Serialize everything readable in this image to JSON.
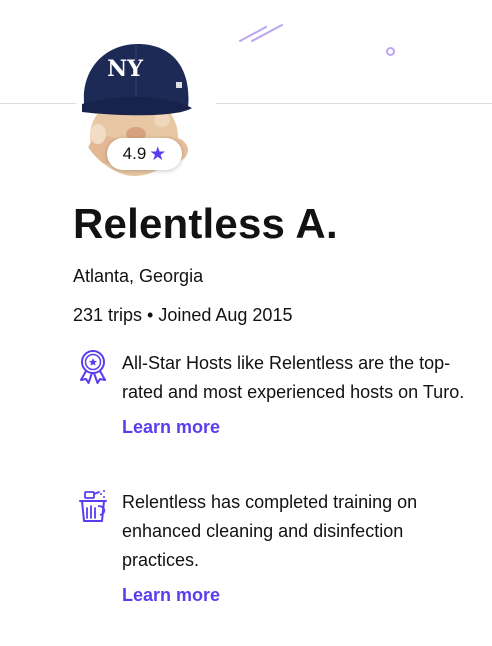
{
  "host": {
    "name": "Relentless A.",
    "location": "Atlanta, Georgia",
    "stats": "231 trips • Joined Aug 2015",
    "rating": "4.9",
    "avatar_cap_logo": "NY"
  },
  "features": [
    {
      "icon": "award-ribbon-icon",
      "text": "All-Star Hosts like Relentless are the top-rated and most experienced hosts on Turo.",
      "link": "Learn more"
    },
    {
      "icon": "cleaning-bucket-icon",
      "text": "Relentless has completed training on enhanced cleaning and disinfection practices.",
      "link": "Learn more"
    }
  ],
  "colors": {
    "accent": "#5a3df0",
    "text": "#121214",
    "divider": "#dcdce0",
    "decor": "#b9a6f2"
  }
}
